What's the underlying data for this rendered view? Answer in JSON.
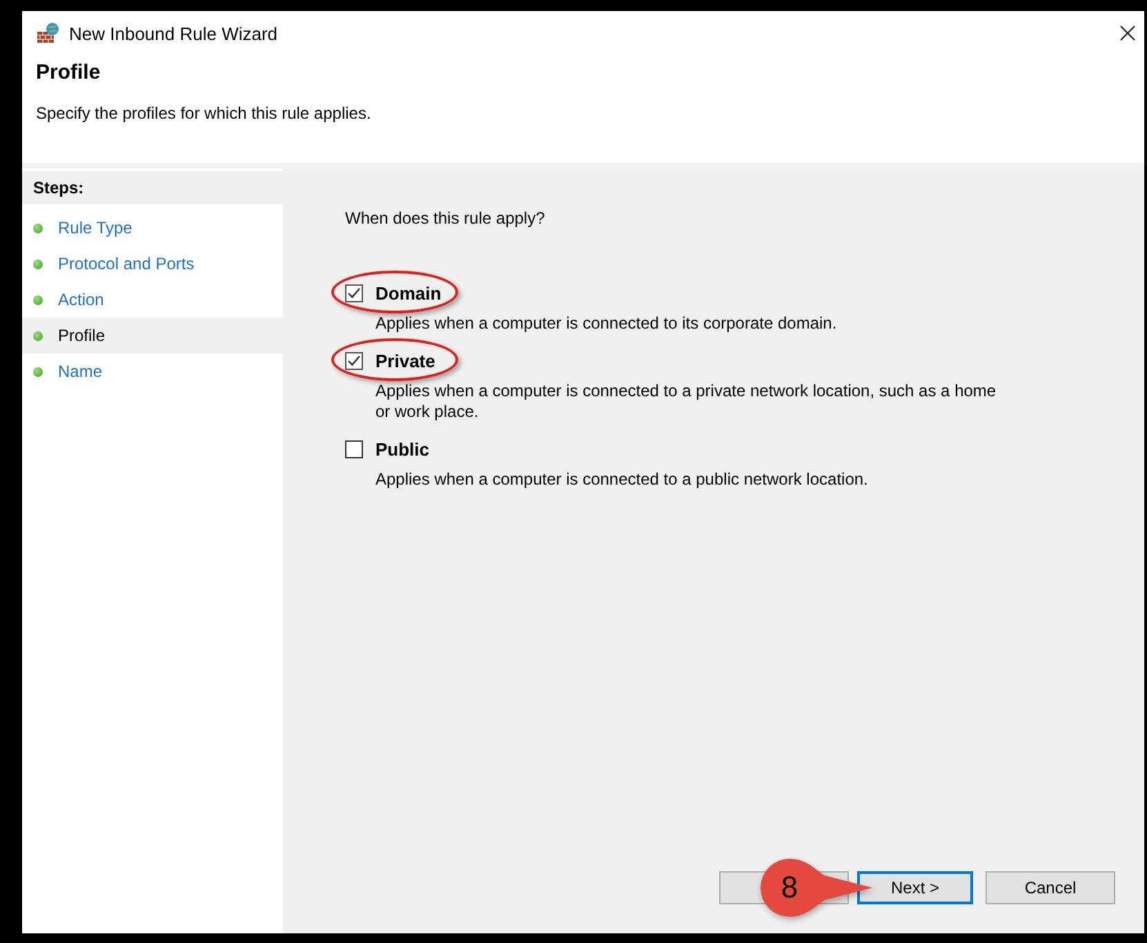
{
  "window": {
    "title": "New Inbound Rule Wizard"
  },
  "header": {
    "title": "Profile",
    "subtitle": "Specify the profiles for which this rule applies."
  },
  "steps": {
    "heading": "Steps:",
    "items": [
      {
        "label": "Rule Type",
        "selected": false
      },
      {
        "label": "Protocol and Ports",
        "selected": false
      },
      {
        "label": "Action",
        "selected": false
      },
      {
        "label": "Profile",
        "selected": true
      },
      {
        "label": "Name",
        "selected": false
      }
    ]
  },
  "question": "When does this rule apply?",
  "options": [
    {
      "label": "Domain",
      "description": "Applies when a computer is connected to its corporate domain.",
      "checked": true,
      "circled": true
    },
    {
      "label": "Private",
      "description": "Applies when a computer is connected to a private network location, such as a home or work place.",
      "checked": true,
      "circled": true
    },
    {
      "label": "Public",
      "description": "Applies when a computer is connected to a public network location.",
      "checked": false,
      "circled": false
    }
  ],
  "buttons": [
    {
      "label": "Next >",
      "default": true
    },
    {
      "label": "Cancel",
      "default": false
    }
  ],
  "callout": {
    "number": "8"
  }
}
